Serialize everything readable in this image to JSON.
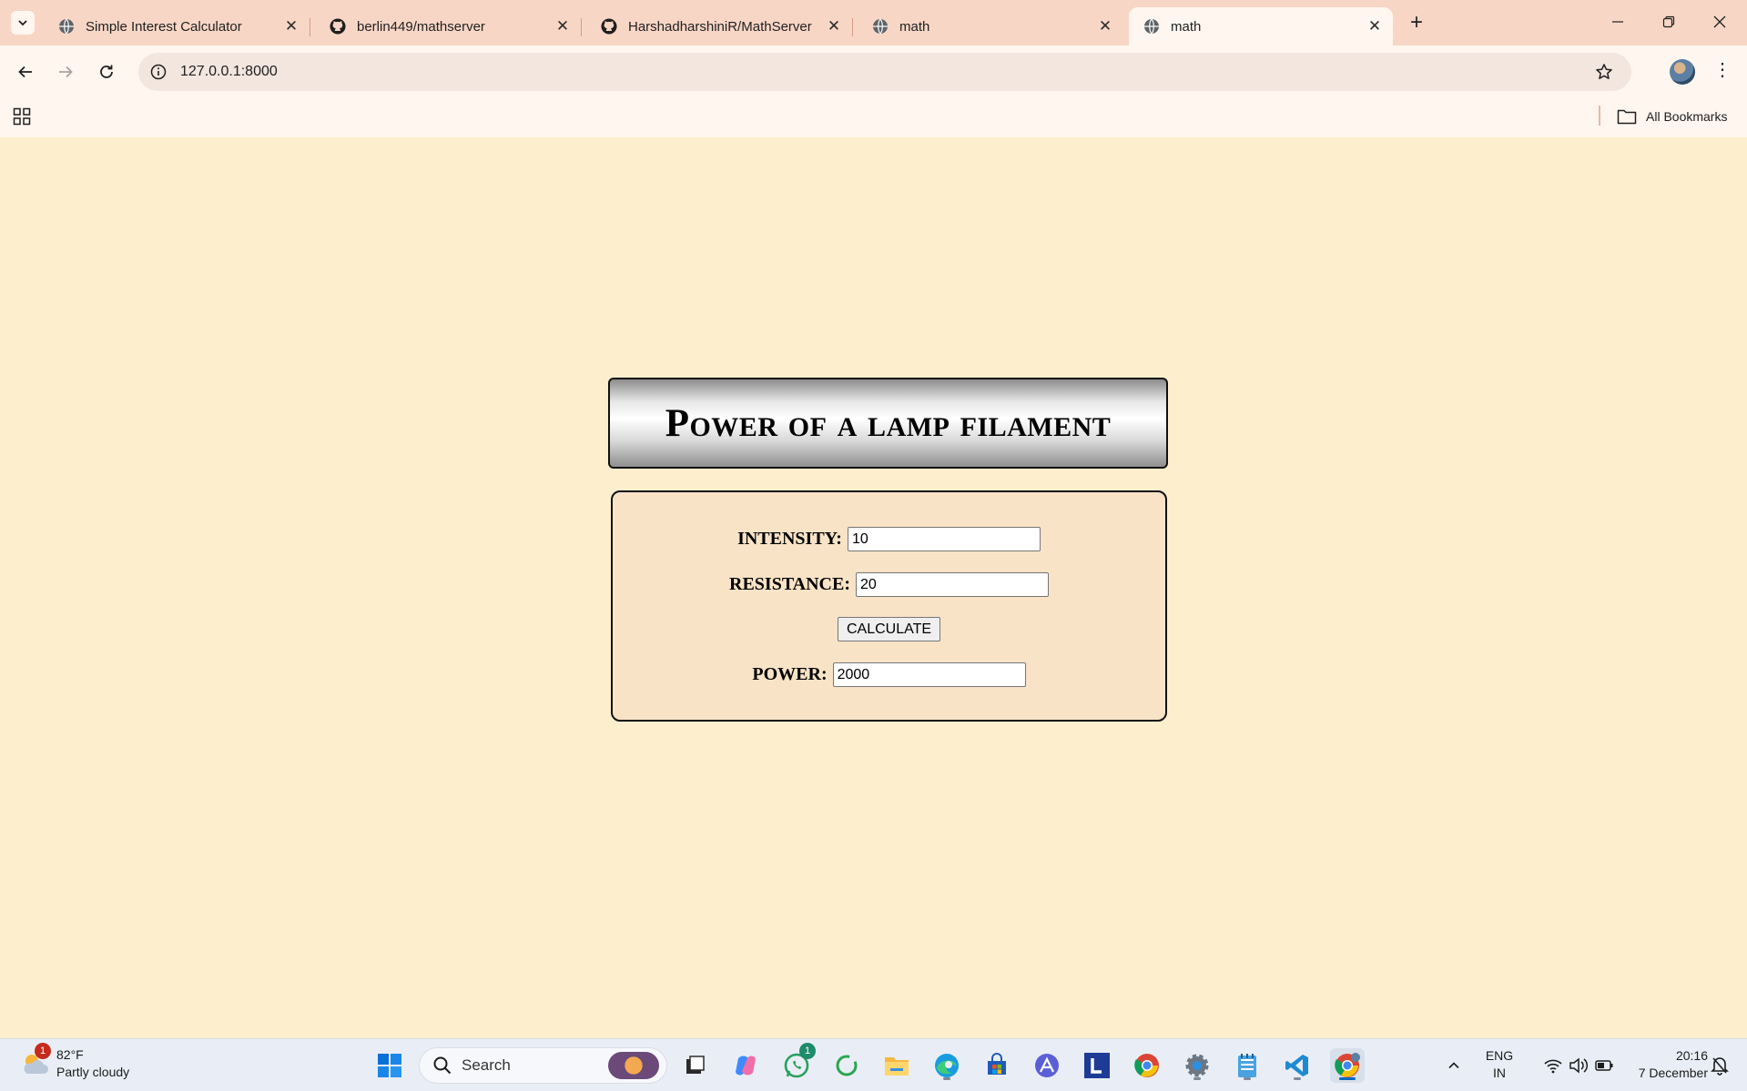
{
  "browser": {
    "tabs": [
      {
        "title": "Simple Interest Calculator",
        "icon": "globe-icon",
        "active": false
      },
      {
        "title": "berlin449/mathserver",
        "icon": "github-icon",
        "active": false
      },
      {
        "title": "HarshadharshiniR/MathServer",
        "icon": "github-icon",
        "active": false
      },
      {
        "title": "math",
        "icon": "globe-icon",
        "active": false
      },
      {
        "title": "math",
        "icon": "globe-icon",
        "active": true
      }
    ],
    "url": "127.0.0.1:8000",
    "bookmarks_label": "All Bookmarks"
  },
  "page": {
    "heading": "Power of a lamp filament",
    "intensity_label": "INTENSITY:",
    "intensity_value": "10",
    "resistance_label": "RESISTANCE:",
    "resistance_value": "20",
    "calculate_label": "CALCULATE",
    "power_label": "POWER:",
    "power_value": "2000",
    "background_color": "#fdeece",
    "form_color": "#f8e3c6"
  },
  "taskbar": {
    "weather_badge": "1",
    "weather_temp": "82°F",
    "weather_desc": "Partly cloudy",
    "search_placeholder": "Search",
    "whatsapp_badge": "1",
    "lang_line1": "ENG",
    "lang_line2": "IN",
    "time": "20:16",
    "date": "7 December",
    "apps": [
      "start-icon",
      "search-icon",
      "task-view-icon",
      "copilot-icon",
      "whatsapp-icon",
      "refresh-app-icon",
      "file-explorer-icon",
      "edge-icon",
      "store-icon",
      "arc-icon",
      "l-app-icon",
      "chrome-icon",
      "settings-icon",
      "notepad-icon",
      "vscode-icon",
      "chrome-active-icon"
    ]
  }
}
